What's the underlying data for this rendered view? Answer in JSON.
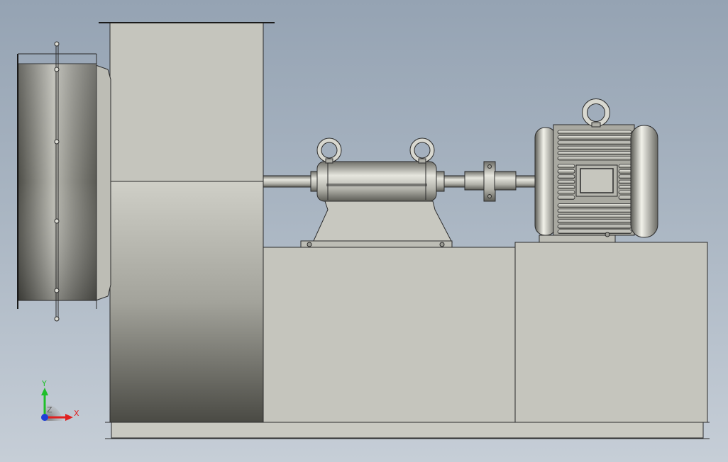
{
  "viewport": {
    "background_top": "#95a3b3",
    "background_bottom": "#c6ced7"
  },
  "model": {
    "parts": [
      "inlet-flange",
      "fan-housing",
      "bearing-pedestal",
      "shaft",
      "coupling",
      "motor",
      "base-frame"
    ]
  },
  "triad": {
    "x_label": "X",
    "y_label": "Y",
    "z_label": "Z",
    "x_color": "#e02020",
    "y_color": "#1fbf2a",
    "z_color": "#1f3fd8"
  }
}
